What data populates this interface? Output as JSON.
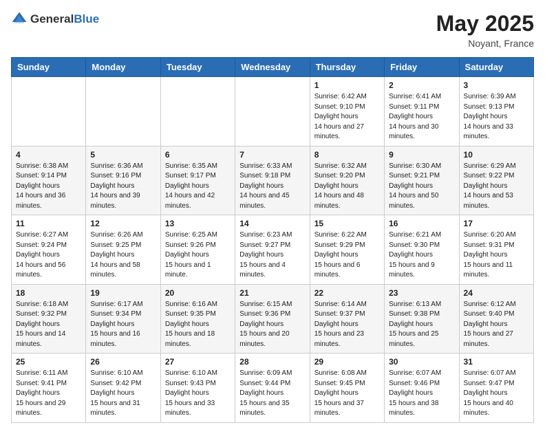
{
  "logo": {
    "text_general": "General",
    "text_blue": "Blue"
  },
  "title": {
    "month_year": "May 2025",
    "location": "Noyant, France"
  },
  "weekdays": [
    "Sunday",
    "Monday",
    "Tuesday",
    "Wednesday",
    "Thursday",
    "Friday",
    "Saturday"
  ],
  "weeks": [
    [
      null,
      null,
      null,
      null,
      {
        "day": 1,
        "sunrise": "6:42 AM",
        "sunset": "9:10 PM",
        "daylight": "14 hours and 27 minutes."
      },
      {
        "day": 2,
        "sunrise": "6:41 AM",
        "sunset": "9:11 PM",
        "daylight": "14 hours and 30 minutes."
      },
      {
        "day": 3,
        "sunrise": "6:39 AM",
        "sunset": "9:13 PM",
        "daylight": "14 hours and 33 minutes."
      }
    ],
    [
      {
        "day": 4,
        "sunrise": "6:38 AM",
        "sunset": "9:14 PM",
        "daylight": "14 hours and 36 minutes."
      },
      {
        "day": 5,
        "sunrise": "6:36 AM",
        "sunset": "9:16 PM",
        "daylight": "14 hours and 39 minutes."
      },
      {
        "day": 6,
        "sunrise": "6:35 AM",
        "sunset": "9:17 PM",
        "daylight": "14 hours and 42 minutes."
      },
      {
        "day": 7,
        "sunrise": "6:33 AM",
        "sunset": "9:18 PM",
        "daylight": "14 hours and 45 minutes."
      },
      {
        "day": 8,
        "sunrise": "6:32 AM",
        "sunset": "9:20 PM",
        "daylight": "14 hours and 48 minutes."
      },
      {
        "day": 9,
        "sunrise": "6:30 AM",
        "sunset": "9:21 PM",
        "daylight": "14 hours and 50 minutes."
      },
      {
        "day": 10,
        "sunrise": "6:29 AM",
        "sunset": "9:22 PM",
        "daylight": "14 hours and 53 minutes."
      }
    ],
    [
      {
        "day": 11,
        "sunrise": "6:27 AM",
        "sunset": "9:24 PM",
        "daylight": "14 hours and 56 minutes."
      },
      {
        "day": 12,
        "sunrise": "6:26 AM",
        "sunset": "9:25 PM",
        "daylight": "14 hours and 58 minutes."
      },
      {
        "day": 13,
        "sunrise": "6:25 AM",
        "sunset": "9:26 PM",
        "daylight": "15 hours and 1 minute."
      },
      {
        "day": 14,
        "sunrise": "6:23 AM",
        "sunset": "9:27 PM",
        "daylight": "15 hours and 4 minutes."
      },
      {
        "day": 15,
        "sunrise": "6:22 AM",
        "sunset": "9:29 PM",
        "daylight": "15 hours and 6 minutes."
      },
      {
        "day": 16,
        "sunrise": "6:21 AM",
        "sunset": "9:30 PM",
        "daylight": "15 hours and 9 minutes."
      },
      {
        "day": 17,
        "sunrise": "6:20 AM",
        "sunset": "9:31 PM",
        "daylight": "15 hours and 11 minutes."
      }
    ],
    [
      {
        "day": 18,
        "sunrise": "6:18 AM",
        "sunset": "9:32 PM",
        "daylight": "15 hours and 14 minutes."
      },
      {
        "day": 19,
        "sunrise": "6:17 AM",
        "sunset": "9:34 PM",
        "daylight": "15 hours and 16 minutes."
      },
      {
        "day": 20,
        "sunrise": "6:16 AM",
        "sunset": "9:35 PM",
        "daylight": "15 hours and 18 minutes."
      },
      {
        "day": 21,
        "sunrise": "6:15 AM",
        "sunset": "9:36 PM",
        "daylight": "15 hours and 20 minutes."
      },
      {
        "day": 22,
        "sunrise": "6:14 AM",
        "sunset": "9:37 PM",
        "daylight": "15 hours and 23 minutes."
      },
      {
        "day": 23,
        "sunrise": "6:13 AM",
        "sunset": "9:38 PM",
        "daylight": "15 hours and 25 minutes."
      },
      {
        "day": 24,
        "sunrise": "6:12 AM",
        "sunset": "9:40 PM",
        "daylight": "15 hours and 27 minutes."
      }
    ],
    [
      {
        "day": 25,
        "sunrise": "6:11 AM",
        "sunset": "9:41 PM",
        "daylight": "15 hours and 29 minutes."
      },
      {
        "day": 26,
        "sunrise": "6:10 AM",
        "sunset": "9:42 PM",
        "daylight": "15 hours and 31 minutes."
      },
      {
        "day": 27,
        "sunrise": "6:10 AM",
        "sunset": "9:43 PM",
        "daylight": "15 hours and 33 minutes."
      },
      {
        "day": 28,
        "sunrise": "6:09 AM",
        "sunset": "9:44 PM",
        "daylight": "15 hours and 35 minutes."
      },
      {
        "day": 29,
        "sunrise": "6:08 AM",
        "sunset": "9:45 PM",
        "daylight": "15 hours and 37 minutes."
      },
      {
        "day": 30,
        "sunrise": "6:07 AM",
        "sunset": "9:46 PM",
        "daylight": "15 hours and 38 minutes."
      },
      {
        "day": 31,
        "sunrise": "6:07 AM",
        "sunset": "9:47 PM",
        "daylight": "15 hours and 40 minutes."
      }
    ]
  ]
}
